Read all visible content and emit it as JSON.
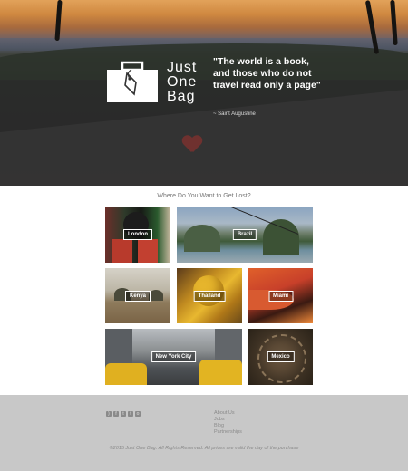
{
  "hero": {
    "brand_line1": "Just",
    "brand_line2": "One",
    "brand_line3": "Bag",
    "quote": "\"The world is a book, and those who do not travel read only a page\"",
    "quote_author": "~ Saint Augustine"
  },
  "destinations": {
    "title": "Where Do You Want to Get Lost?",
    "items": [
      {
        "label": "London"
      },
      {
        "label": "Brazil"
      },
      {
        "label": "Kenya"
      },
      {
        "label": "Thailand"
      },
      {
        "label": "Miami"
      },
      {
        "label": "New York City"
      },
      {
        "label": "Mexico"
      }
    ]
  },
  "footer": {
    "social_icons": [
      "rss-icon",
      "facebook-icon",
      "twitter-icon",
      "tumblr-icon",
      "instagram-icon"
    ],
    "links": [
      "About Us",
      "Jobs",
      "Blog",
      "Partnerships"
    ],
    "copyright": "©2015 Just One Bag. All Rights Reserved. All prices are valid the day of the purchase"
  }
}
